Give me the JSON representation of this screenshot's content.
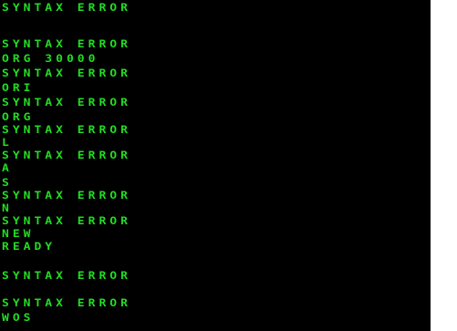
{
  "terminal": {
    "text_color": "#22dd22",
    "background_color": "#000000",
    "lines": [
      "SYNTAX ERROR",
      "",
      "SYNTAX ERROR",
      "ORG 30000",
      "SYNTAX ERROR",
      "ORI",
      "SYNTAX ERROR",
      "ORG",
      "SYNTAX ERROR",
      "L",
      "SYNTAX ERROR",
      "A",
      "S",
      "SYNTAX ERROR",
      "N",
      "SYNTAX ERROR",
      "NEW",
      "READY",
      "",
      "SYNTAX ERROR",
      "",
      "SYNTAX ERROR",
      "WOS"
    ]
  }
}
